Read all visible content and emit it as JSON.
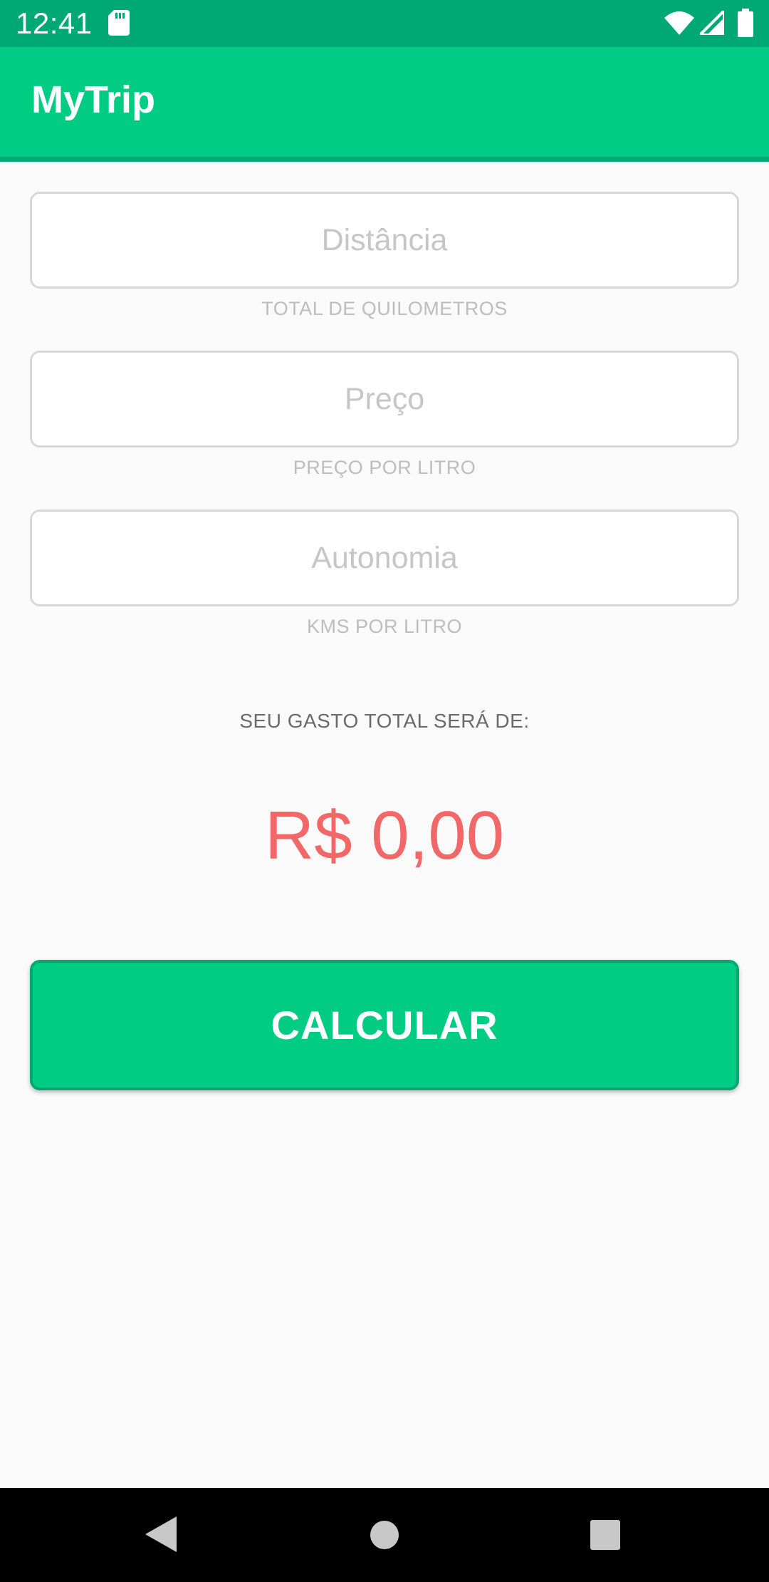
{
  "status_bar": {
    "time": "12:41",
    "icons": [
      "sd-card-icon",
      "wifi-icon",
      "cell-signal-icon",
      "battery-icon"
    ]
  },
  "app_bar": {
    "title": "MyTrip",
    "color": "#00cc83"
  },
  "form": {
    "fields": [
      {
        "placeholder": "Distância",
        "value": "",
        "helper": "TOTAL DE QUILOMETROS"
      },
      {
        "placeholder": "Preço",
        "value": "",
        "helper": "PREÇO POR LITRO"
      },
      {
        "placeholder": "Autonomia",
        "value": "",
        "helper": "KMS POR LITRO"
      }
    ]
  },
  "result": {
    "label": "SEU GASTO TOTAL SERÁ DE:",
    "value": "R$ 0,00",
    "color": "#f26767"
  },
  "button": {
    "label": "CALCULAR",
    "color": "#00cc83"
  },
  "nav_bar": {
    "icons": [
      "back-icon",
      "home-icon",
      "recents-icon"
    ]
  }
}
